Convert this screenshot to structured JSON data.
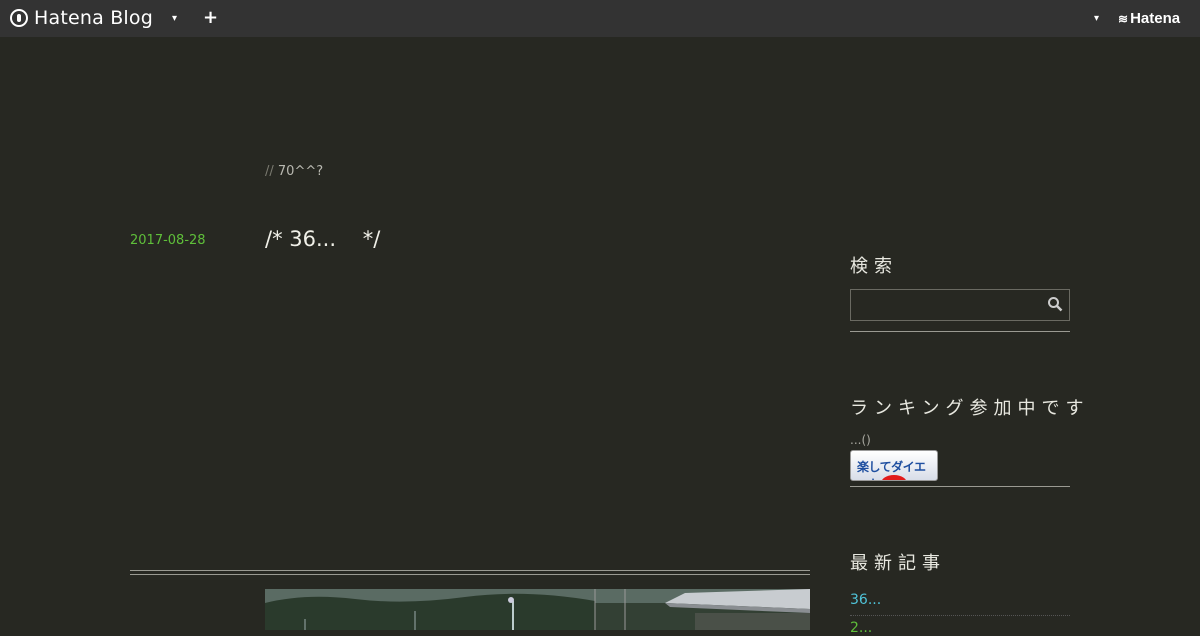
{
  "topbar": {
    "logo_text": "Hatena Blog",
    "plus_label": "+",
    "brand_text": "Hatena",
    "dropdown_glyph": "▾"
  },
  "blog": {
    "description_prefix": "//",
    "description": "70^^?"
  },
  "entry": {
    "date": "2017-08-28",
    "title": "/* 36...    */"
  },
  "sidebar": {
    "search_title": "検索",
    "search_placeholder": "",
    "banner_section_title": "ランキング参加中です",
    "banner_note": "...()",
    "banner_text": "楽してダイエット",
    "recent_title": "最新記事",
    "recent_items": [
      "36...",
      "2..."
    ]
  },
  "colors": {
    "background": "#272822",
    "topbar": "#333333",
    "date_green": "#5fbf3a",
    "link_cyan": "#4fc3d8"
  }
}
